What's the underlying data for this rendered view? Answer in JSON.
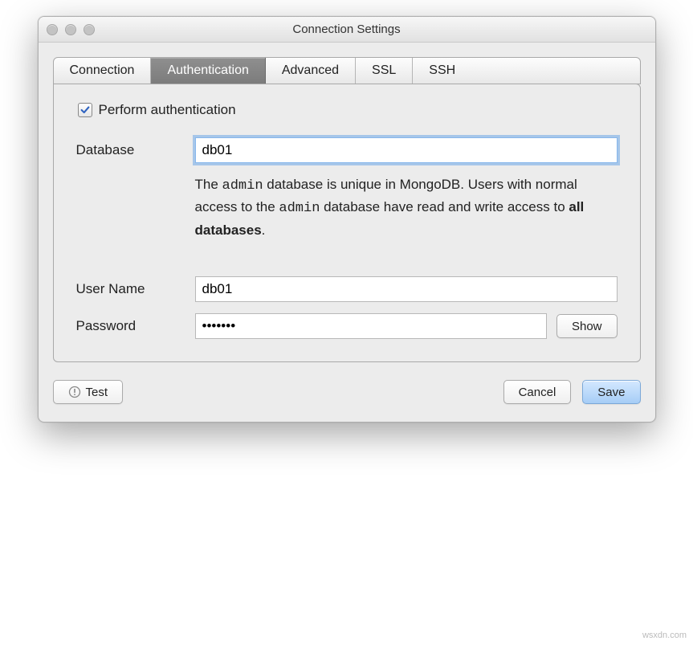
{
  "window": {
    "title": "Connection Settings"
  },
  "tabs": {
    "connection": "Connection",
    "authentication": "Authentication",
    "advanced": "Advanced",
    "ssl": "SSL",
    "ssh": "SSH"
  },
  "auth": {
    "perform_label": "Perform authentication",
    "perform_checked": true,
    "database_label": "Database",
    "database_value": "db01",
    "help_prefix": "The ",
    "help_admin1": "admin",
    "help_mid1": " database is unique in MongoDB. Users with normal access to the ",
    "help_admin2": "admin",
    "help_mid2": " database have read and write access to ",
    "help_bold": "all databases",
    "help_suffix": ".",
    "username_label": "User Name",
    "username_value": "db01",
    "password_label": "Password",
    "password_value": "•••••••",
    "show_label": "Show"
  },
  "footer": {
    "test_label": "Test",
    "cancel_label": "Cancel",
    "save_label": "Save"
  },
  "watermark": "wsxdn.com"
}
